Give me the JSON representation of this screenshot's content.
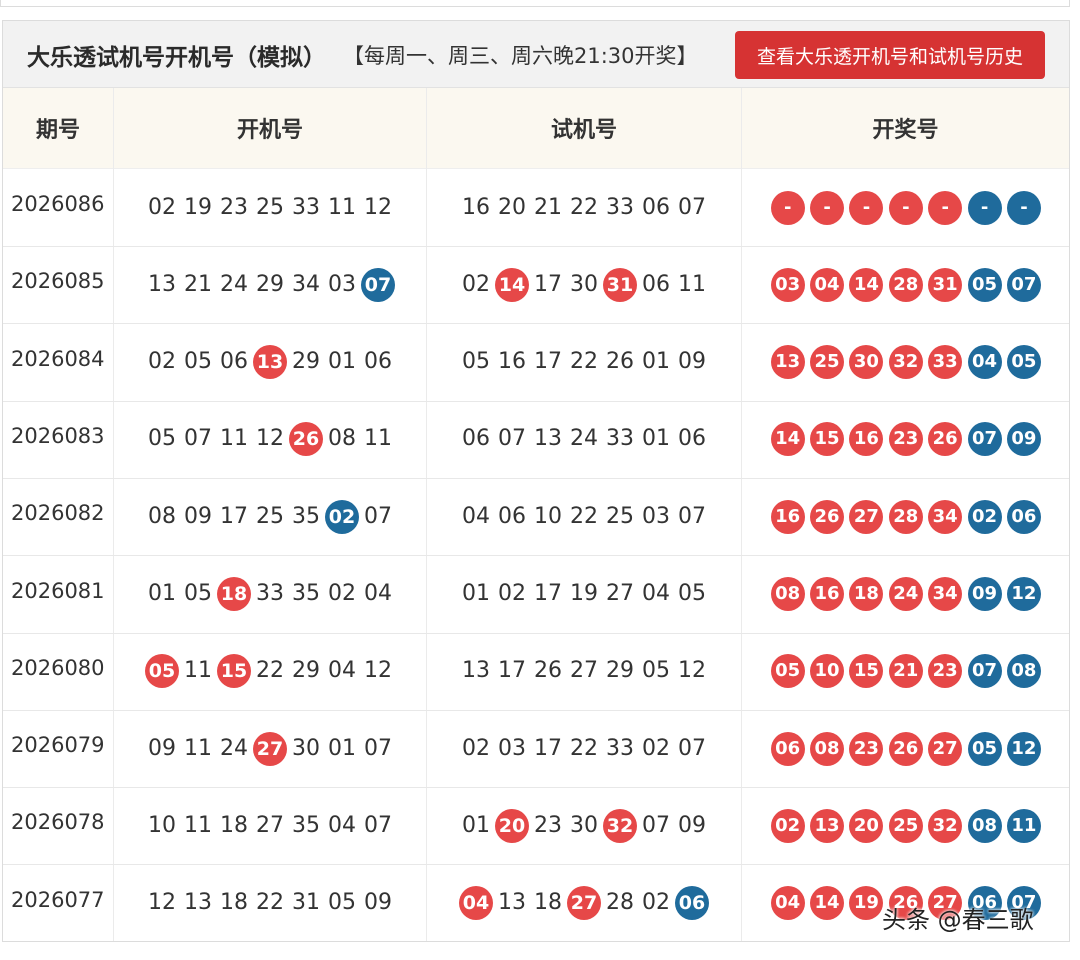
{
  "header": {
    "title": "大乐透试机号开机号（模拟）",
    "subtitle": "【每周一、周三、周六晚21:30开奖】",
    "history_button": "查看大乐透开机号和试机号历史"
  },
  "columns": [
    "期号",
    "开机号",
    "试机号",
    "开奖号"
  ],
  "colors": {
    "red": "#e64848",
    "blue": "#1f6b9c",
    "button": "#d63333"
  },
  "rows": [
    {
      "period": "2026086",
      "kaiji": [
        {
          "n": "02"
        },
        {
          "n": "19"
        },
        {
          "n": "23"
        },
        {
          "n": "25"
        },
        {
          "n": "33"
        },
        {
          "n": "11"
        },
        {
          "n": "12"
        }
      ],
      "shiji": [
        {
          "n": "16"
        },
        {
          "n": "20"
        },
        {
          "n": "21"
        },
        {
          "n": "22"
        },
        {
          "n": "33"
        },
        {
          "n": "06"
        },
        {
          "n": "07"
        }
      ],
      "kaijiang": [
        "-",
        "-",
        "-",
        "-",
        "-",
        "-",
        "-"
      ]
    },
    {
      "period": "2026085",
      "kaiji": [
        {
          "n": "13"
        },
        {
          "n": "21"
        },
        {
          "n": "24"
        },
        {
          "n": "29"
        },
        {
          "n": "34"
        },
        {
          "n": "03"
        },
        {
          "n": "07",
          "hl": "blue"
        }
      ],
      "shiji": [
        {
          "n": "02"
        },
        {
          "n": "14",
          "hl": "red"
        },
        {
          "n": "17"
        },
        {
          "n": "30"
        },
        {
          "n": "31",
          "hl": "red"
        },
        {
          "n": "06"
        },
        {
          "n": "11"
        }
      ],
      "kaijiang": [
        "03",
        "04",
        "14",
        "28",
        "31",
        "05",
        "07"
      ]
    },
    {
      "period": "2026084",
      "kaiji": [
        {
          "n": "02"
        },
        {
          "n": "05"
        },
        {
          "n": "06"
        },
        {
          "n": "13",
          "hl": "red"
        },
        {
          "n": "29"
        },
        {
          "n": "01"
        },
        {
          "n": "06"
        }
      ],
      "shiji": [
        {
          "n": "05"
        },
        {
          "n": "16"
        },
        {
          "n": "17"
        },
        {
          "n": "22"
        },
        {
          "n": "26"
        },
        {
          "n": "01"
        },
        {
          "n": "09"
        }
      ],
      "kaijiang": [
        "13",
        "25",
        "30",
        "32",
        "33",
        "04",
        "05"
      ]
    },
    {
      "period": "2026083",
      "kaiji": [
        {
          "n": "05"
        },
        {
          "n": "07"
        },
        {
          "n": "11"
        },
        {
          "n": "12"
        },
        {
          "n": "26",
          "hl": "red"
        },
        {
          "n": "08"
        },
        {
          "n": "11"
        }
      ],
      "shiji": [
        {
          "n": "06"
        },
        {
          "n": "07"
        },
        {
          "n": "13"
        },
        {
          "n": "24"
        },
        {
          "n": "33"
        },
        {
          "n": "01"
        },
        {
          "n": "06"
        }
      ],
      "kaijiang": [
        "14",
        "15",
        "16",
        "23",
        "26",
        "07",
        "09"
      ]
    },
    {
      "period": "2026082",
      "kaiji": [
        {
          "n": "08"
        },
        {
          "n": "09"
        },
        {
          "n": "17"
        },
        {
          "n": "25"
        },
        {
          "n": "35"
        },
        {
          "n": "02",
          "hl": "blue"
        },
        {
          "n": "07"
        }
      ],
      "shiji": [
        {
          "n": "04"
        },
        {
          "n": "06"
        },
        {
          "n": "10"
        },
        {
          "n": "22"
        },
        {
          "n": "25"
        },
        {
          "n": "03"
        },
        {
          "n": "07"
        }
      ],
      "kaijiang": [
        "16",
        "26",
        "27",
        "28",
        "34",
        "02",
        "06"
      ]
    },
    {
      "period": "2026081",
      "kaiji": [
        {
          "n": "01"
        },
        {
          "n": "05"
        },
        {
          "n": "18",
          "hl": "red"
        },
        {
          "n": "33"
        },
        {
          "n": "35"
        },
        {
          "n": "02"
        },
        {
          "n": "04"
        }
      ],
      "shiji": [
        {
          "n": "01"
        },
        {
          "n": "02"
        },
        {
          "n": "17"
        },
        {
          "n": "19"
        },
        {
          "n": "27"
        },
        {
          "n": "04"
        },
        {
          "n": "05"
        }
      ],
      "kaijiang": [
        "08",
        "16",
        "18",
        "24",
        "34",
        "09",
        "12"
      ]
    },
    {
      "period": "2026080",
      "kaiji": [
        {
          "n": "05",
          "hl": "red"
        },
        {
          "n": "11"
        },
        {
          "n": "15",
          "hl": "red"
        },
        {
          "n": "22"
        },
        {
          "n": "29"
        },
        {
          "n": "04"
        },
        {
          "n": "12"
        }
      ],
      "shiji": [
        {
          "n": "13"
        },
        {
          "n": "17"
        },
        {
          "n": "26"
        },
        {
          "n": "27"
        },
        {
          "n": "29"
        },
        {
          "n": "05"
        },
        {
          "n": "12"
        }
      ],
      "kaijiang": [
        "05",
        "10",
        "15",
        "21",
        "23",
        "07",
        "08"
      ]
    },
    {
      "period": "2026079",
      "kaiji": [
        {
          "n": "09"
        },
        {
          "n": "11"
        },
        {
          "n": "24"
        },
        {
          "n": "27",
          "hl": "red"
        },
        {
          "n": "30"
        },
        {
          "n": "01"
        },
        {
          "n": "07"
        }
      ],
      "shiji": [
        {
          "n": "02"
        },
        {
          "n": "03"
        },
        {
          "n": "17"
        },
        {
          "n": "22"
        },
        {
          "n": "33"
        },
        {
          "n": "02"
        },
        {
          "n": "07"
        }
      ],
      "kaijiang": [
        "06",
        "08",
        "23",
        "26",
        "27",
        "05",
        "12"
      ]
    },
    {
      "period": "2026078",
      "kaiji": [
        {
          "n": "10"
        },
        {
          "n": "11"
        },
        {
          "n": "18"
        },
        {
          "n": "27"
        },
        {
          "n": "35"
        },
        {
          "n": "04"
        },
        {
          "n": "07"
        }
      ],
      "shiji": [
        {
          "n": "01"
        },
        {
          "n": "20",
          "hl": "red"
        },
        {
          "n": "23"
        },
        {
          "n": "30"
        },
        {
          "n": "32",
          "hl": "red"
        },
        {
          "n": "07"
        },
        {
          "n": "09"
        }
      ],
      "kaijiang": [
        "02",
        "13",
        "20",
        "25",
        "32",
        "08",
        "11"
      ]
    },
    {
      "period": "2026077",
      "kaiji": [
        {
          "n": "12"
        },
        {
          "n": "13"
        },
        {
          "n": "18"
        },
        {
          "n": "22"
        },
        {
          "n": "31"
        },
        {
          "n": "05"
        },
        {
          "n": "09"
        }
      ],
      "shiji": [
        {
          "n": "04",
          "hl": "red"
        },
        {
          "n": "13"
        },
        {
          "n": "18"
        },
        {
          "n": "27",
          "hl": "red"
        },
        {
          "n": "28"
        },
        {
          "n": "02"
        },
        {
          "n": "06",
          "hl": "blue"
        }
      ],
      "kaijiang": [
        "04",
        "14",
        "19",
        "26",
        "27",
        "06",
        "07"
      ]
    }
  ],
  "watermark": "头条 @春三歌"
}
